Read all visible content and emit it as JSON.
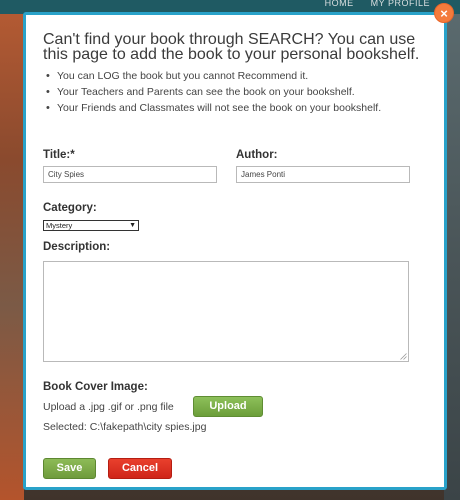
{
  "background_nav": {
    "items": [
      "HOME",
      "MY PROFILE"
    ]
  },
  "modal": {
    "close_label": "×",
    "heading": "Can't find your book through SEARCH? You can use this page to add the book to your personal bookshelf.",
    "notes": [
      "You can LOG the book but you cannot Recommend it.",
      "Your Teachers and Parents can see the book on your bookshelf.",
      "Your Friends and Classmates will not see the book on your bookshelf."
    ],
    "title_field": {
      "label": "Title:*",
      "value": "City Spies"
    },
    "author_field": {
      "label": "Author:",
      "value": "James Ponti"
    },
    "category_field": {
      "label": "Category:",
      "selected": "Mystery"
    },
    "description_field": {
      "label": "Description:",
      "value": ""
    },
    "cover": {
      "label": "Book Cover Image:",
      "hint": "Upload a .jpg .gif or .png file",
      "upload_label": "Upload",
      "selected_text": "Selected: C:\\fakepath\\city spies.jpg"
    },
    "save_label": "Save",
    "cancel_label": "Cancel"
  },
  "colors": {
    "modal_border": "#29a2c9",
    "close_button": "#f47b3c",
    "save_button": "#7aab48",
    "upload_button": "#7aab48",
    "cancel_button": "#dc3122"
  }
}
